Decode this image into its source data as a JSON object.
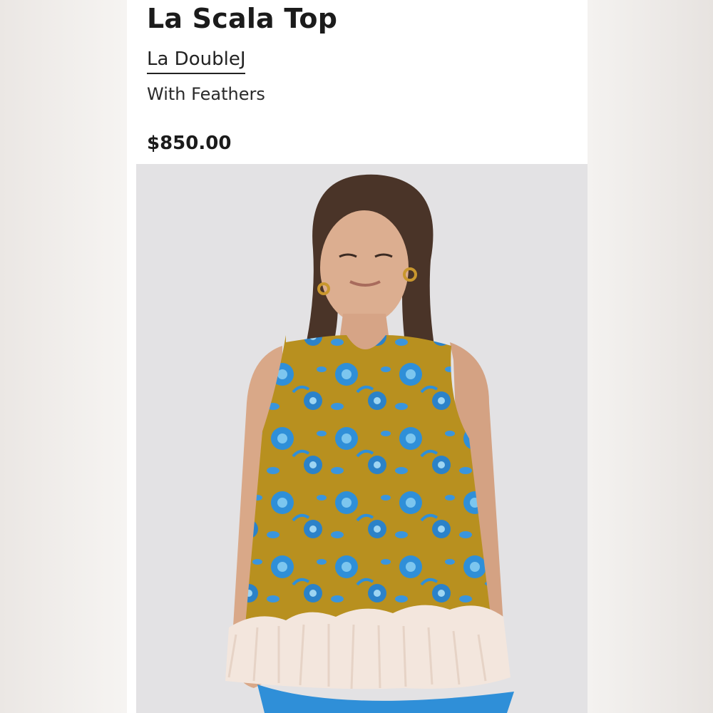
{
  "product": {
    "title": "La Scala Top",
    "brand": "La DoubleJ",
    "variant": "With Feathers",
    "price": "$850.00"
  },
  "image": {
    "subject": "model-wearing-floral-top",
    "colors": {
      "background": "#e3e2e4",
      "fabric_base": "#b8901f",
      "fabric_flower": "#2f8fd8",
      "feathers": "#f3e6dd",
      "skin": "#d9a888",
      "hair": "#4a3428"
    }
  }
}
